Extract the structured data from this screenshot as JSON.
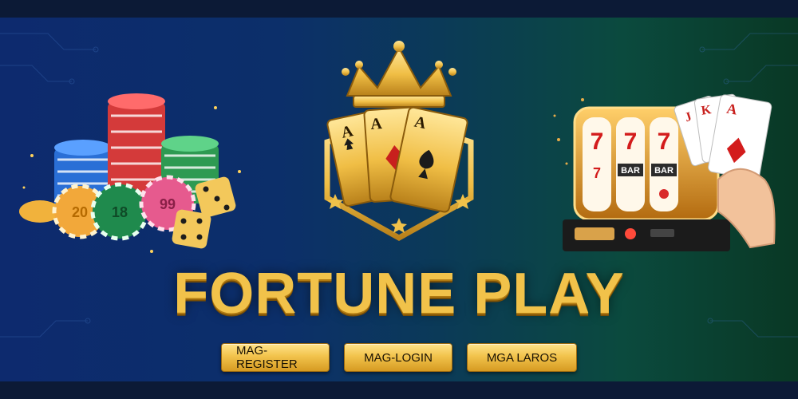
{
  "banner": {
    "title": "FORTUNE PLAY",
    "buttons": [
      {
        "label": "MAG-REGISTER"
      },
      {
        "label": "MAG-LOGIN"
      },
      {
        "label": "MGA LAROS"
      }
    ]
  },
  "emblem": {
    "cards": [
      "A",
      "A",
      "A"
    ],
    "card_suits": [
      "spade-icon",
      "diamond-icon",
      "spade-icon"
    ]
  },
  "chips": {
    "labels": [
      "20",
      "18",
      "99"
    ]
  },
  "slot_machine": {
    "reel_symbols": [
      "7",
      "7",
      "7",
      "7",
      "BAR",
      "BAR"
    ],
    "hand_cards": [
      "J",
      "K",
      "A"
    ]
  },
  "colors": {
    "gold": "#f1c24a",
    "bg_left": "#0d2a6e",
    "bg_right": "#093824"
  }
}
